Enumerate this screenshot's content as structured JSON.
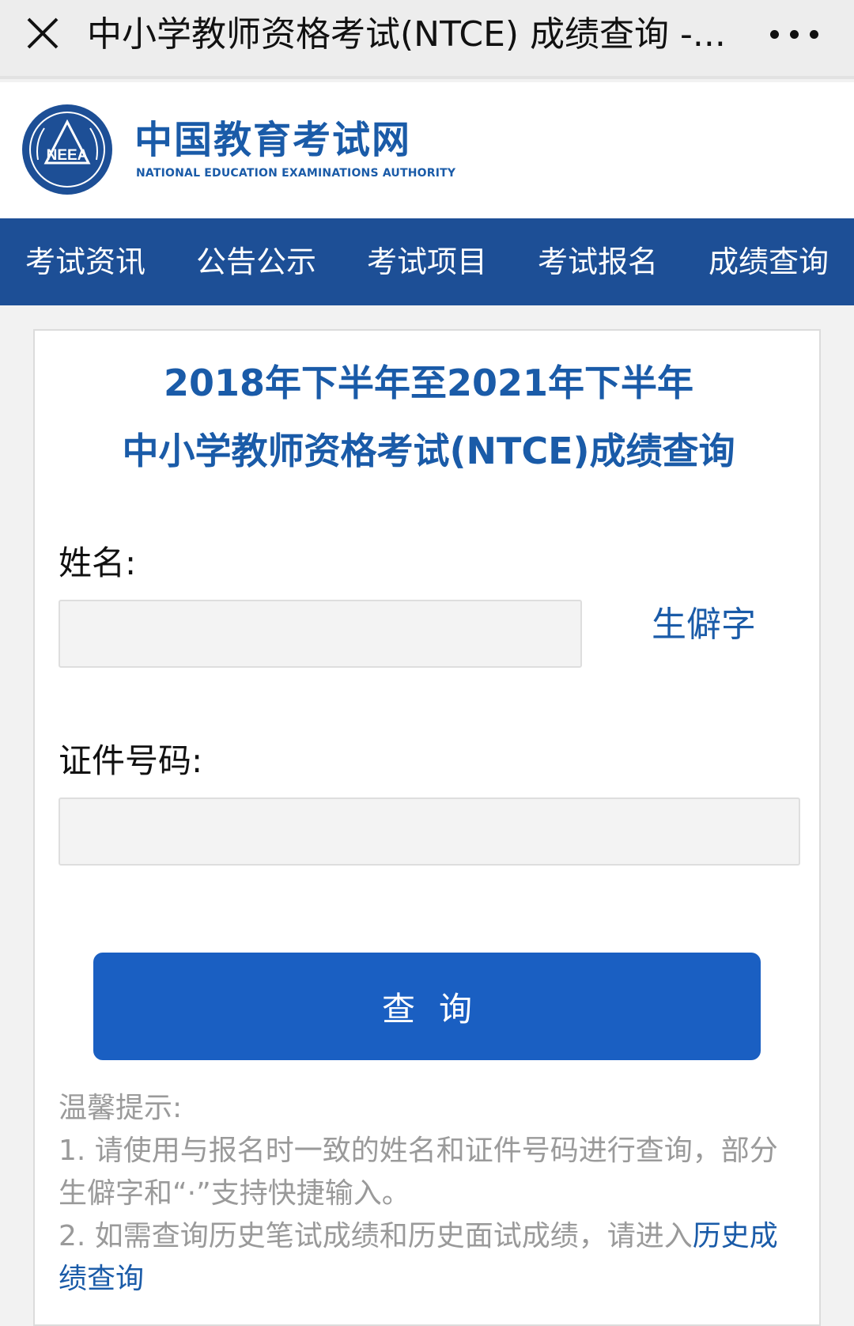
{
  "topbar": {
    "title": "中小学教师资格考试(NTCE) 成绩查询 -...",
    "close_icon": "close-icon",
    "more_icon": "more-icon"
  },
  "header": {
    "logo_cn": "中国教育考试网",
    "logo_en": "NATIONAL EDUCATION EXAMINATIONS AUTHORITY",
    "emblem_text": "NEEA"
  },
  "nav": {
    "items": [
      {
        "label": "考试资讯"
      },
      {
        "label": "公告公示"
      },
      {
        "label": "考试项目"
      },
      {
        "label": "考试报名"
      },
      {
        "label": "成绩查询"
      }
    ]
  },
  "form": {
    "title_line1": "2018年下半年至2021年下半年",
    "title_line2": "中小学教师资格考试(NTCE)成绩查询",
    "name_label": "姓名:",
    "name_value": "",
    "rare_char_link": "生僻字",
    "id_label": "证件号码:",
    "id_value": "",
    "query_button": "查询"
  },
  "tips": {
    "heading": "温馨提示:",
    "line1": "1. 请使用与报名时一致的姓名和证件号码进行查询，部分生僻字和“·”支持快捷输入。",
    "line2_text": "2. 如需查询历史笔试成绩和历史面试成绩，请进入",
    "line2_link": "历史成绩查询"
  },
  "colors": {
    "brand_blue": "#1a5ba8",
    "nav_bg": "#1d4f96",
    "button_bg": "#1a5fc2",
    "tip_gray": "#9a9a9a"
  }
}
